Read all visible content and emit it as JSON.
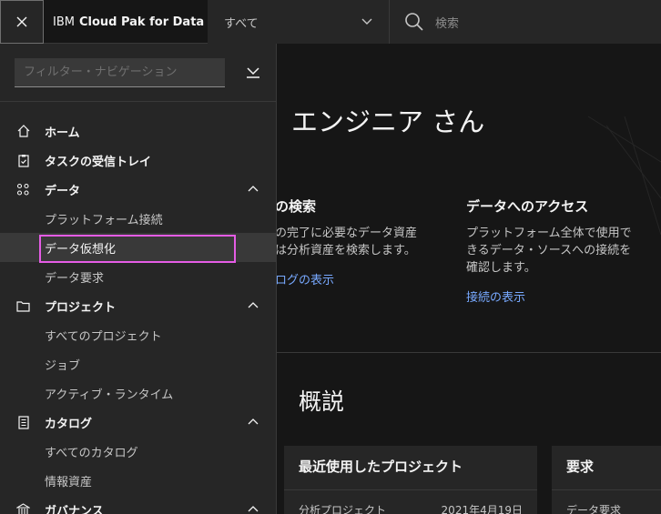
{
  "header": {
    "brand_prefix": "IBM",
    "brand_name": "Cloud Pak for Data",
    "scope": "すべて",
    "search_placeholder": "検索"
  },
  "sidebar": {
    "filter_placeholder": "フィルター・ナビゲーション",
    "items": [
      {
        "label": "ホーム",
        "icon": "home-icon"
      },
      {
        "label": "タスクの受信トレイ",
        "icon": "clipboard-icon"
      },
      {
        "label": "データ",
        "icon": "data-icon",
        "children": [
          "プラットフォーム接続",
          "データ仮想化",
          "データ要求"
        ]
      },
      {
        "label": "プロジェクト",
        "icon": "folder-icon",
        "children": [
          "すべてのプロジェクト",
          "ジョブ",
          "アクティブ・ランタイム"
        ]
      },
      {
        "label": "カタログ",
        "icon": "catalog-icon",
        "children": [
          "すべてのカタログ",
          "情報資産"
        ]
      },
      {
        "label": "ガバナンス",
        "icon": "governance-icon"
      }
    ],
    "active_item": "データ仮想化"
  },
  "main": {
    "greeting": "エンジニア さん",
    "card_search": {
      "title": "の検索",
      "line1": "の完了に必要なデータ資産",
      "line2": "は分析資産を検索します。",
      "link": "ログの表示"
    },
    "card_access": {
      "title": "データへのアクセス",
      "line1": "プラットフォーム全体で使用で",
      "line2": "きるデータ・ソースへの接続を",
      "line3": "確認します。",
      "link": "接続の表示"
    },
    "overview_title": "概説",
    "tile_recent": {
      "title": "最近使用したプロジェクト",
      "row_name": "分析プロジェクト",
      "row_date": "2021年4月19日"
    },
    "tile_requests": {
      "title": "要求",
      "row_name": "データ要求"
    }
  },
  "colors": {
    "accent_link": "#78a9ff",
    "highlight": "#e55ce5",
    "sidebar_bg": "#262626",
    "page_bg": "#161616"
  }
}
